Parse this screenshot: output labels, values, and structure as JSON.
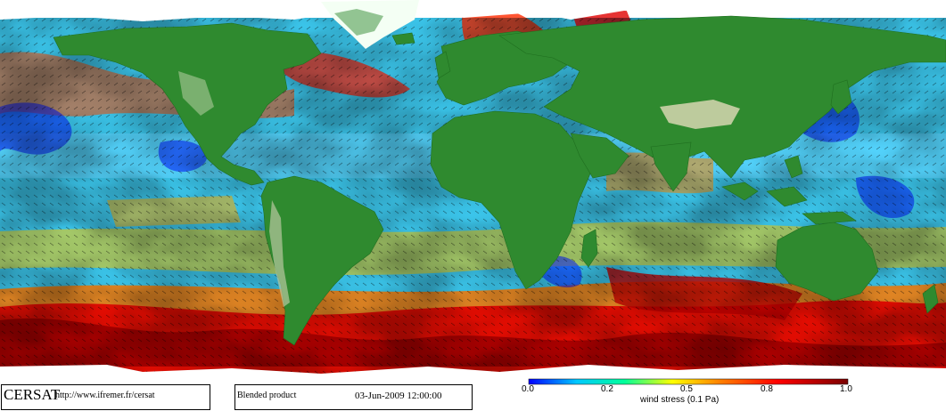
{
  "map": {
    "legend": {
      "ticks": [
        "0.0",
        "0.2",
        "0.5",
        "0.8",
        "1.0"
      ],
      "label": "wind stress (0.1 Pa)",
      "scale_stops": [
        "#0000ff",
        "#00c8ff",
        "#00ff9a",
        "#ffff00",
        "#ff8000",
        "#ff0000",
        "#7a0000"
      ]
    }
  },
  "footer": {
    "logo_text": "CERSAT",
    "url_text": "http://www.ifremer.fr/cersat",
    "product_text": "Blended product",
    "date_text": "03-Jun-2009 12:00:00"
  },
  "colors": {
    "land": "#2f8a2f",
    "land_high": "#d6d6b0",
    "ice": "#ffffff",
    "ocean_low": "#0000ff",
    "ocean_mid": "#33d0ff",
    "ocean_high": "#ff0000"
  }
}
